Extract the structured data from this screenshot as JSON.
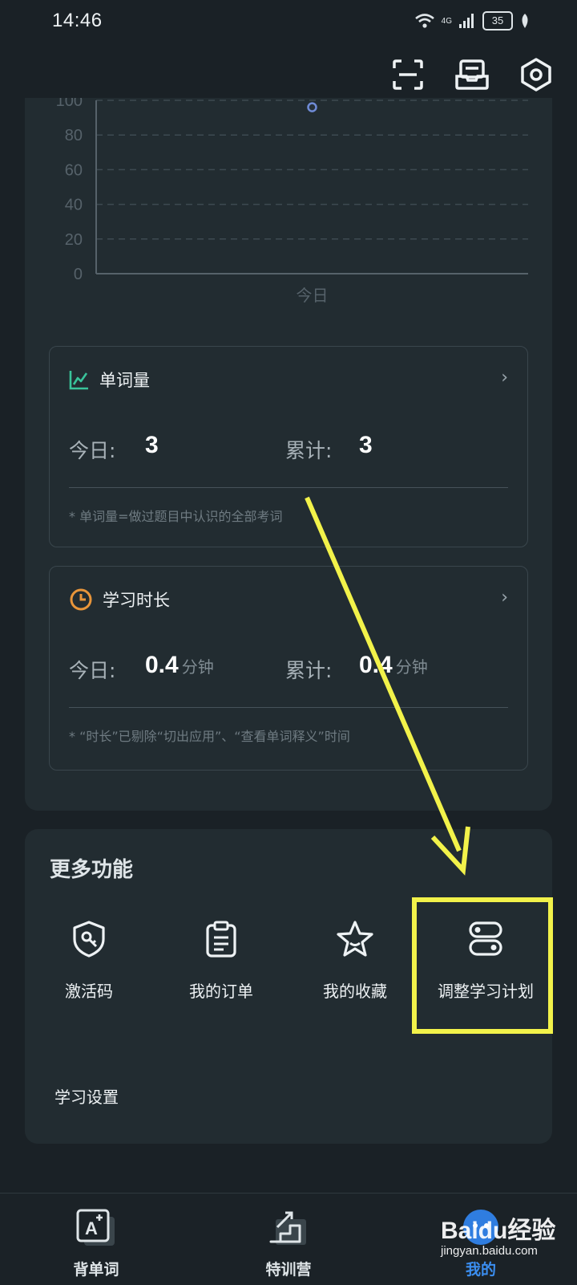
{
  "status_bar": {
    "time": "14:46",
    "network": "4G",
    "battery": "35"
  },
  "top_icons": [
    "scan-icon",
    "inbox-icon",
    "settings-icon"
  ],
  "chart_data": {
    "type": "line",
    "categories": [
      "今日"
    ],
    "values": [
      96
    ],
    "ylim": [
      0,
      100
    ],
    "yticks": [
      0,
      20,
      40,
      60,
      80,
      100
    ],
    "grid": true
  },
  "word_card": {
    "title": "单词量",
    "today_label": "今日:",
    "today_value": "3",
    "total_label": "累计:",
    "total_value": "3",
    "note": "* 单词量=做过题目中认识的全部考词"
  },
  "time_card": {
    "title": "学习时长",
    "today_label": "今日:",
    "today_value": "0.4",
    "today_unit": "分钟",
    "total_label": "累计:",
    "total_value": "0.4",
    "total_unit": "分钟",
    "note": "* “时长”已剔除“切出应用”、“查看单词释义”时间"
  },
  "more": {
    "title": "更多功能",
    "features": [
      {
        "label": "激活码",
        "icon": "shield-key-icon"
      },
      {
        "label": "我的订单",
        "icon": "clipboard-icon"
      },
      {
        "label": "我的收藏",
        "icon": "star-icon"
      },
      {
        "label": "调整学习计划",
        "icon": "toggle-plan-icon"
      }
    ],
    "settings_label": "学习设置"
  },
  "tabs": [
    {
      "label": "背单词",
      "icon": "word-card-icon"
    },
    {
      "label": "特训营",
      "icon": "stairs-icon"
    },
    {
      "label": "我的",
      "icon": "profile-icon"
    }
  ],
  "watermark": {
    "logo": "Baidu经验",
    "url": "jingyan.baidu.com"
  },
  "colors": {
    "background": "#1a2126",
    "card": "#222c31",
    "accent_green": "#39c39a",
    "accent_orange": "#e8953a",
    "highlight": "#f2f24a"
  }
}
